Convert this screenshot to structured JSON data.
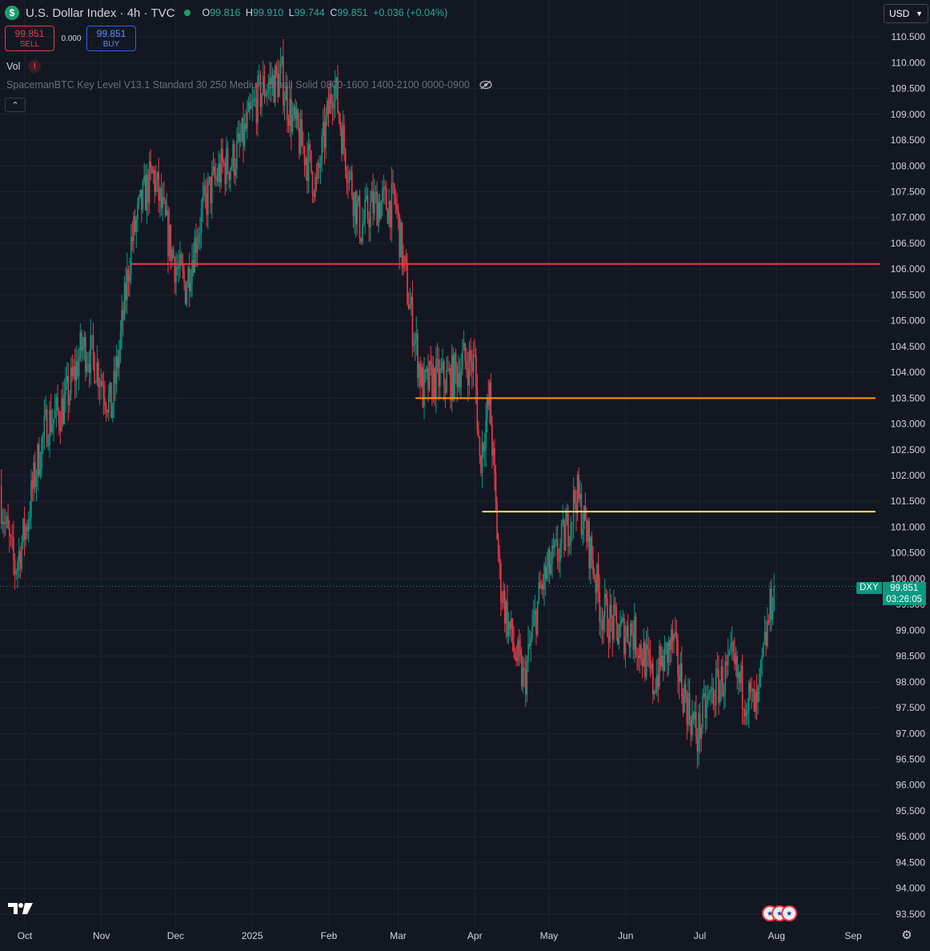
{
  "header": {
    "symbol_icon": "$",
    "title": "U.S. Dollar Index · 4h · TVC",
    "ohlc": {
      "o_label": "O",
      "o_value": "99.816",
      "h_label": "H",
      "h_value": "99.910",
      "l_label": "L",
      "l_value": "99.744",
      "c_label": "C",
      "c_value": "99.851",
      "change": "+0.036 (+0.04%)"
    },
    "status_color": "#1e9c70"
  },
  "trade": {
    "sell_price": "99.851",
    "sell_label": "SELL",
    "spread": "0.000",
    "buy_price": "99.851",
    "buy_label": "BUY"
  },
  "vol_label": "Vol",
  "warning_icon": "!",
  "indicator_label": "SpacemanBTC Key Level V13.1 Standard 30 250 Medium Small Solid 0800-1600 1400-2100 0000-0900",
  "currency": "USD",
  "price_label": {
    "symbol": "DXY",
    "price": "99.851",
    "countdown": "03:26:05"
  },
  "colors": {
    "background": "#131722",
    "up": "#089981",
    "down": "#f23645",
    "level_red": "#f23645",
    "level_orange": "#ff9800",
    "level_yellow": "#ffeb3b"
  },
  "chart_data": {
    "type": "candlestick",
    "y_range": [
      93.5,
      110.5
    ],
    "y_ticks": [
      "93.500",
      "94.000",
      "94.500",
      "95.000",
      "95.500",
      "96.000",
      "96.500",
      "97.000",
      "97.500",
      "98.000",
      "98.500",
      "99.000",
      "99.500",
      "100.000",
      "100.500",
      "101.000",
      "101.500",
      "102.000",
      "102.500",
      "103.000",
      "103.500",
      "104.000",
      "104.500",
      "105.000",
      "105.500",
      "106.000",
      "106.500",
      "107.000",
      "107.500",
      "108.000",
      "108.500",
      "109.000",
      "109.500",
      "110.000",
      "110.500"
    ],
    "x_ticks": [
      "Oct",
      "Nov",
      "Dec",
      "2025",
      "Feb",
      "Mar",
      "Apr",
      "May",
      "Jun",
      "Jul",
      "Aug",
      "Sep"
    ],
    "x_tick_dates": [
      "2024-10-01",
      "2024-11-01",
      "2024-12-01",
      "2025-01-01",
      "2025-02-01",
      "2025-03-01",
      "2025-04-01",
      "2025-05-01",
      "2025-06-01",
      "2025-07-01",
      "2025-08-01",
      "2025-09-01"
    ],
    "x_range": [
      "2024-09-21",
      "2025-09-12"
    ],
    "price_path": [
      {
        "date": "2024-09-21",
        "close": 101.8
      },
      {
        "date": "2024-09-27",
        "close": 100.4
      },
      {
        "date": "2024-10-02",
        "close": 101.0
      },
      {
        "date": "2024-10-10",
        "close": 102.9
      },
      {
        "date": "2024-10-24",
        "close": 104.4
      },
      {
        "date": "2024-11-05",
        "close": 103.4
      },
      {
        "date": "2024-11-13",
        "close": 106.6
      },
      {
        "date": "2024-11-22",
        "close": 107.6
      },
      {
        "date": "2024-12-05",
        "close": 105.8
      },
      {
        "date": "2024-12-20",
        "close": 108.1
      },
      {
        "date": "2024-12-31",
        "close": 108.8
      },
      {
        "date": "2025-01-13",
        "close": 109.9
      },
      {
        "date": "2025-01-27",
        "close": 107.3
      },
      {
        "date": "2025-02-03",
        "close": 109.8
      },
      {
        "date": "2025-02-14",
        "close": 106.7
      },
      {
        "date": "2025-02-28",
        "close": 107.5
      },
      {
        "date": "2025-03-11",
        "close": 103.4
      },
      {
        "date": "2025-03-27",
        "close": 104.4
      },
      {
        "date": "2025-04-01",
        "close": 104.0
      },
      {
        "date": "2025-04-03",
        "close": 102.0
      },
      {
        "date": "2025-04-07",
        "close": 103.3
      },
      {
        "date": "2025-04-11",
        "close": 100.1
      },
      {
        "date": "2025-04-21",
        "close": 98.0
      },
      {
        "date": "2025-04-28",
        "close": 99.6
      },
      {
        "date": "2025-05-12",
        "close": 101.8
      },
      {
        "date": "2025-05-22",
        "close": 99.2
      },
      {
        "date": "2025-06-03",
        "close": 99.2
      },
      {
        "date": "2025-06-12",
        "close": 97.7
      },
      {
        "date": "2025-06-20",
        "close": 99.0
      },
      {
        "date": "2025-06-30",
        "close": 96.8
      },
      {
        "date": "2025-07-14",
        "close": 98.6
      },
      {
        "date": "2025-07-24",
        "close": 97.2
      },
      {
        "date": "2025-07-31",
        "close": 99.85
      }
    ],
    "levels": [
      {
        "price": 106.1,
        "color": "#f23645",
        "from": "2024-11-13",
        "to": "2025-09-12"
      },
      {
        "price": 103.5,
        "color": "#ff9800",
        "from": "2025-03-08",
        "to": "2025-09-10"
      },
      {
        "price": 101.3,
        "color": "#ffeb3b",
        "from": "2025-04-04",
        "to": "2025-09-10"
      }
    ],
    "last_price": 99.851
  }
}
